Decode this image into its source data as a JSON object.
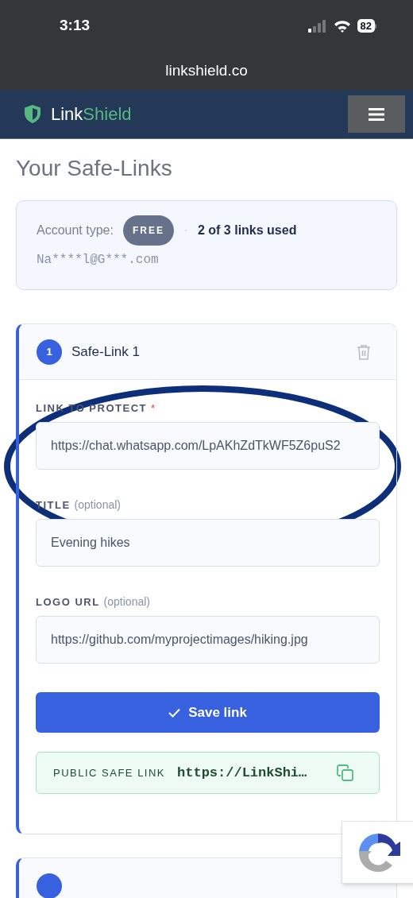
{
  "status_bar": {
    "time": "3:13",
    "battery": "82"
  },
  "address_bar": {
    "url": "linkshield.co"
  },
  "navbar": {
    "brand": [
      {
        "text": "Link",
        "accent": false
      },
      {
        "text": "Shield",
        "accent": true
      }
    ]
  },
  "page_title": "Your Safe-Links",
  "account": {
    "label": "Account type:",
    "plan": "FREE",
    "usage": "2 of 3 links used",
    "email": "Na****l@G***.com"
  },
  "links": [
    {
      "expanded": true,
      "number": "1",
      "title": "Safe-Link 1",
      "fields": [
        {
          "label": "LINK TO PROTECT",
          "required_mark": "*",
          "value": "https://chat.whatsapp.com/LpAKhZdTkWF5Z6puS2"
        },
        {
          "label": "TITLE",
          "hint": "(optional)",
          "value": "Evening hikes"
        },
        {
          "label": "LOGO URL",
          "hint": "(optional)",
          "value": "https://github.com/myprojectimages/hiking.jpg"
        }
      ],
      "save_button": "Save link",
      "public_link": {
        "label": "PUBLIC SAFE LINK",
        "value": "https://LinkShi…"
      }
    },
    {
      "expanded": false
    }
  ]
}
